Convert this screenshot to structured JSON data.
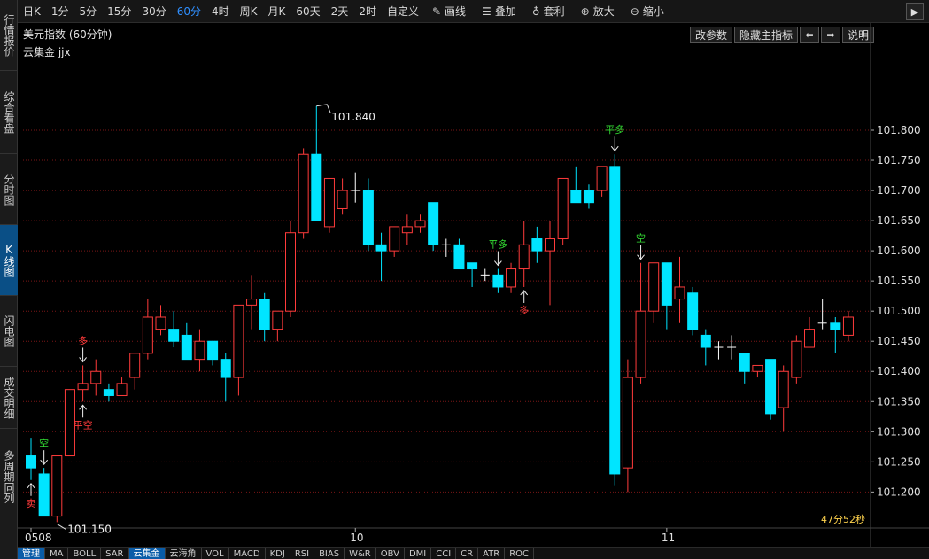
{
  "sidebar": {
    "tabs": [
      {
        "label": "行情报价",
        "active": false
      },
      {
        "label": "综合看盘",
        "active": false
      },
      {
        "label": "分时图",
        "active": false
      },
      {
        "label": "K线图",
        "active": true
      },
      {
        "label": "闪电图",
        "active": false
      },
      {
        "label": "成交明细",
        "active": false
      },
      {
        "label": "多周期同列",
        "active": false
      }
    ]
  },
  "toolbar": {
    "periods": [
      "日K",
      "1分",
      "5分",
      "15分",
      "30分",
      "60分",
      "4时",
      "周K",
      "月K",
      "60天",
      "2天",
      "2时",
      "自定义"
    ],
    "selected_period": "60分",
    "tools": [
      {
        "label": "画线",
        "icon": "pencil-icon"
      },
      {
        "label": "叠加",
        "icon": "stack-icon"
      },
      {
        "label": "套利",
        "icon": "moneybag-icon"
      },
      {
        "label": "放大",
        "icon": "zoom-in-icon"
      },
      {
        "label": "缩小",
        "icon": "zoom-out-icon"
      }
    ]
  },
  "chart_header": {
    "title": "美元指数 (60分钟)",
    "indicator": "云集金 jjx",
    "buttons": [
      "改参数",
      "隐藏主指标",
      "说明"
    ]
  },
  "countdown": "47分52秒",
  "bottom_tabs": [
    "管理",
    "MA",
    "BOLL",
    "SAR",
    "云集金",
    "云海角",
    "VOL",
    "MACD",
    "KDJ",
    "RSI",
    "BIAS",
    "W&R",
    "OBV",
    "DMI",
    "CCI",
    "CR",
    "ATR",
    "ROC"
  ],
  "bottom_selected": [
    "管理",
    "云集金"
  ],
  "colors": {
    "up": "#ff3b3b",
    "down": "#00e5ff",
    "grid": "#7a1616",
    "signal_long": "#ff3b3b",
    "signal_short": "#33dd33",
    "countdown": "#ffd34d"
  },
  "chart_data": {
    "type": "candlestick",
    "x_labels": [
      "0508",
      "10",
      "11"
    ],
    "x_label_index": [
      0,
      25,
      49
    ],
    "y_ticks": [
      "101.800",
      "101.750",
      "101.700",
      "101.650",
      "101.600",
      "101.550",
      "101.500",
      "101.450",
      "101.400",
      "101.350",
      "101.300",
      "101.250",
      "101.200"
    ],
    "ylim": [
      101.155,
      101.872
    ],
    "high_label": "101.840",
    "low_label": "101.150",
    "high_index": 22,
    "low_index": 2,
    "candles": [
      [
        101.26,
        101.29,
        101.22,
        101.24
      ],
      [
        101.23,
        101.24,
        101.17,
        101.16
      ],
      [
        101.16,
        101.26,
        101.15,
        101.26
      ],
      [
        101.26,
        101.37,
        101.26,
        101.37
      ],
      [
        101.37,
        101.41,
        101.35,
        101.38
      ],
      [
        101.38,
        101.42,
        101.36,
        101.4
      ],
      [
        101.37,
        101.38,
        101.35,
        101.36
      ],
      [
        101.36,
        101.39,
        101.36,
        101.38
      ],
      [
        101.39,
        101.43,
        101.37,
        101.43
      ],
      [
        101.43,
        101.52,
        101.42,
        101.49
      ],
      [
        101.47,
        101.51,
        101.46,
        101.49
      ],
      [
        101.47,
        101.5,
        101.44,
        101.45
      ],
      [
        101.46,
        101.48,
        101.42,
        101.42
      ],
      [
        101.42,
        101.47,
        101.4,
        101.45
      ],
      [
        101.45,
        101.45,
        101.41,
        101.42
      ],
      [
        101.42,
        101.43,
        101.35,
        101.39
      ],
      [
        101.39,
        101.51,
        101.36,
        101.51
      ],
      [
        101.51,
        101.56,
        101.47,
        101.52
      ],
      [
        101.52,
        101.53,
        101.45,
        101.47
      ],
      [
        101.47,
        101.49,
        101.45,
        101.5
      ],
      [
        101.5,
        101.65,
        101.49,
        101.63
      ],
      [
        101.63,
        101.77,
        101.62,
        101.76
      ],
      [
        101.76,
        101.84,
        101.65,
        101.65
      ],
      [
        101.64,
        101.72,
        101.63,
        101.72
      ],
      [
        101.67,
        101.72,
        101.66,
        101.7
      ],
      [
        101.7,
        101.73,
        101.68,
        101.7
      ],
      [
        101.7,
        101.72,
        101.6,
        101.61
      ],
      [
        101.61,
        101.63,
        101.55,
        101.6
      ],
      [
        101.6,
        101.64,
        101.59,
        101.64
      ],
      [
        101.63,
        101.66,
        101.61,
        101.64
      ],
      [
        101.64,
        101.66,
        101.63,
        101.65
      ],
      [
        101.68,
        101.68,
        101.6,
        101.61
      ],
      [
        101.61,
        101.62,
        101.59,
        101.61
      ],
      [
        101.61,
        101.62,
        101.57,
        101.57
      ],
      [
        101.58,
        101.58,
        101.54,
        101.57
      ],
      [
        101.56,
        101.57,
        101.55,
        101.56
      ],
      [
        101.56,
        101.57,
        101.53,
        101.54
      ],
      [
        101.54,
        101.58,
        101.53,
        101.57
      ],
      [
        101.57,
        101.65,
        101.54,
        101.61
      ],
      [
        101.62,
        101.64,
        101.58,
        101.6
      ],
      [
        101.6,
        101.65,
        101.51,
        101.62
      ],
      [
        101.62,
        101.72,
        101.61,
        101.72
      ],
      [
        101.7,
        101.74,
        101.68,
        101.68
      ],
      [
        101.7,
        101.71,
        101.67,
        101.68
      ],
      [
        101.7,
        101.74,
        101.69,
        101.74
      ],
      [
        101.74,
        101.76,
        101.21,
        101.23
      ],
      [
        101.24,
        101.42,
        101.2,
        101.39
      ],
      [
        101.39,
        101.58,
        101.38,
        101.5
      ],
      [
        101.5,
        101.58,
        101.48,
        101.58
      ],
      [
        101.58,
        101.58,
        101.47,
        101.51
      ],
      [
        101.52,
        101.59,
        101.48,
        101.54
      ],
      [
        101.53,
        101.54,
        101.46,
        101.47
      ],
      [
        101.46,
        101.47,
        101.41,
        101.44
      ],
      [
        101.44,
        101.45,
        101.42,
        101.44
      ],
      [
        101.44,
        101.46,
        101.42,
        101.44
      ],
      [
        101.43,
        101.43,
        101.38,
        101.4
      ],
      [
        101.4,
        101.41,
        101.39,
        101.41
      ],
      [
        101.42,
        101.42,
        101.32,
        101.33
      ],
      [
        101.34,
        101.41,
        101.3,
        101.4
      ],
      [
        101.39,
        101.46,
        101.38,
        101.45
      ],
      [
        101.44,
        101.49,
        101.44,
        101.47
      ],
      [
        101.48,
        101.52,
        101.47,
        101.48
      ],
      [
        101.48,
        101.49,
        101.43,
        101.47
      ],
      [
        101.46,
        101.5,
        101.45,
        101.49
      ]
    ],
    "signals": [
      {
        "i": 0,
        "label": "卖",
        "dir": "up",
        "color": "#ff3b3b"
      },
      {
        "i": 1,
        "label": "空",
        "dir": "down",
        "color": "#33dd33"
      },
      {
        "i": 4,
        "label": "平空",
        "dir": "up",
        "color": "#ff3b3b"
      },
      {
        "i": 4,
        "label": "多",
        "dir": "down",
        "color": "#ff3b3b"
      },
      {
        "i": 36,
        "label": "平多",
        "dir": "down",
        "color": "#33dd33"
      },
      {
        "i": 38,
        "label": "多",
        "dir": "up",
        "color": "#ff3b3b"
      },
      {
        "i": 45,
        "label": "平多",
        "dir": "down",
        "color": "#33dd33"
      },
      {
        "i": 47,
        "label": "空",
        "dir": "down",
        "color": "#33dd33"
      }
    ]
  }
}
